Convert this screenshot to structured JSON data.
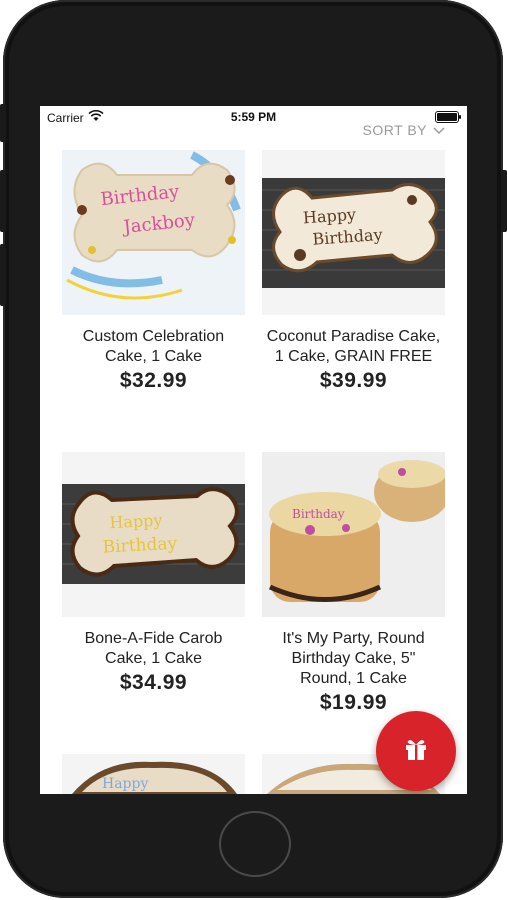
{
  "status": {
    "carrier": "Carrier",
    "time": "5:59 PM"
  },
  "header": {
    "sort_label": "SORT BY"
  },
  "products": [
    {
      "name": "Custom Celebration Cake, 1 Cake",
      "price": "$32.99"
    },
    {
      "name": "Coconut Paradise Cake, 1 Cake, GRAIN FREE",
      "price": "$39.99"
    },
    {
      "name": "Bone-A-Fide Carob Cake, 1 Cake",
      "price": "$34.99"
    },
    {
      "name": "It's My Party, Round Birthday Cake, 5\" Round, 1 Cake",
      "price": "$19.99"
    },
    {
      "name": "",
      "price": ""
    },
    {
      "name": "",
      "price": ""
    }
  ],
  "fab": {
    "icon": "gift-icon",
    "color": "#d8232a"
  }
}
